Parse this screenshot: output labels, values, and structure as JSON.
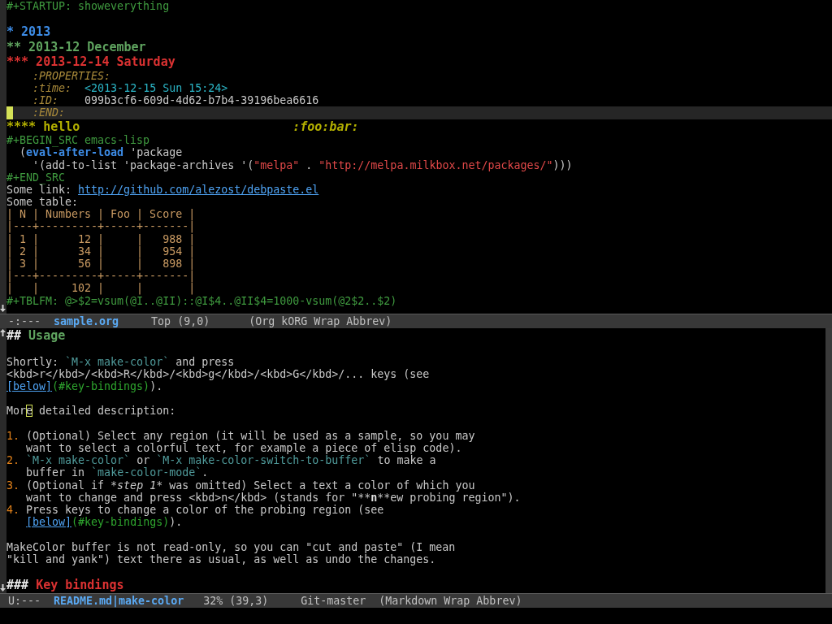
{
  "panes": [
    {
      "fringe": {
        "top_arrow": false,
        "bottom_arrow": true
      },
      "scroll_bar": false,
      "lines": [
        {
          "kind": "text",
          "current": false,
          "segments": [
            {
              "text": "#+STARTUP: showeverything",
              "kind": "meta"
            }
          ]
        },
        {
          "kind": "text",
          "current": false
        },
        {
          "kind": "heading",
          "current": false,
          "segments": [
            {
              "text": "* 2013",
              "kind": "h1"
            }
          ]
        },
        {
          "kind": "heading",
          "current": false,
          "segments": [
            {
              "text": "** 2013-12 December",
              "kind": "h2"
            }
          ]
        },
        {
          "kind": "heading",
          "current": false,
          "segments": [
            {
              "text": "*** 2013-12-14 Saturday",
              "kind": "h3"
            }
          ]
        },
        {
          "kind": "text",
          "current": false,
          "segments": [
            {
              "text": "    :PROPERTIES:",
              "kind": "drawer"
            }
          ]
        },
        {
          "kind": "text",
          "current": false,
          "segments": [
            {
              "text": "    :time:",
              "kind": "drawer"
            },
            {
              "text": "  <2013-12-15 Sun 15:24>",
              "kind": "date"
            }
          ]
        },
        {
          "kind": "text",
          "current": false,
          "segments": [
            {
              "text": "    :ID:",
              "kind": "drawer"
            },
            {
              "text": "    099b3cf6-609d-4d62-b7b4-39196bea6616",
              "kind": "default"
            }
          ]
        },
        {
          "kind": "text",
          "current": true,
          "segments": [
            {
              "text": "    :END:",
              "kind": "drawer"
            }
          ]
        },
        {
          "kind": "heading",
          "current": false,
          "segments": [
            {
              "text": "**** hello",
              "kind": "h4"
            },
            {
              "text": "                             :foo:bar:",
              "kind": "tag"
            }
          ]
        },
        {
          "kind": "text",
          "current": false,
          "segments": [
            {
              "text": "#+BEGIN_SRC emacs-lisp",
              "kind": "meta"
            }
          ]
        },
        {
          "kind": "text",
          "current": false,
          "segments": [
            {
              "text": "  (",
              "kind": "default"
            },
            {
              "text": "eval-after-load",
              "kind": "keyword"
            },
            {
              "text": " 'package",
              "kind": "default"
            }
          ]
        },
        {
          "kind": "text",
          "current": false,
          "segments": [
            {
              "text": "    '(add-to-list 'package-archives '(",
              "kind": "default"
            },
            {
              "text": "\"melpa\"",
              "kind": "string"
            },
            {
              "text": " . ",
              "kind": "default"
            },
            {
              "text": "\"http://melpa.milkbox.net/packages/\"",
              "kind": "string"
            },
            {
              "text": ")))",
              "kind": "default"
            }
          ]
        },
        {
          "kind": "text",
          "current": false,
          "segments": [
            {
              "text": "#+END_SRC",
              "kind": "meta"
            }
          ]
        },
        {
          "kind": "text",
          "current": false,
          "segments": [
            {
              "text": "Some link:",
              "kind": "default"
            },
            {
              "text": " http://github.com/alezost/debpaste.el",
              "kind": "link"
            }
          ]
        },
        {
          "kind": "text",
          "current": false,
          "segments": [
            {
              "text": "Some table:",
              "kind": "default"
            }
          ]
        },
        {
          "kind": "text",
          "current": false,
          "segments": [
            {
              "text": "| N | Numbers | Foo | Score |",
              "kind": "table"
            }
          ]
        },
        {
          "kind": "text",
          "current": false,
          "segments": [
            {
              "text": "|---+---------+-----+-------|",
              "kind": "table"
            }
          ]
        },
        {
          "kind": "text",
          "current": false,
          "segments": [
            {
              "text": "| 1 |      12 |     |   988 |",
              "kind": "table"
            }
          ]
        },
        {
          "kind": "text",
          "current": false,
          "segments": [
            {
              "text": "| 2 |      34 |     |   954 |",
              "kind": "table"
            }
          ]
        },
        {
          "kind": "text",
          "current": false,
          "segments": [
            {
              "text": "| 3 |      56 |     |   898 |",
              "kind": "table"
            }
          ]
        },
        {
          "kind": "text",
          "current": false,
          "segments": [
            {
              "text": "|---+---------+-----+-------|",
              "kind": "table"
            }
          ]
        },
        {
          "kind": "text",
          "current": false,
          "segments": [
            {
              "text": "|   |     102 |     |       |",
              "kind": "table"
            }
          ]
        },
        {
          "kind": "text",
          "current": false,
          "segments": [
            {
              "text": "#+TBLFM: @>$2=vsum(@I..@II)::@I$4..@II$4=1000-vsum(@2$2..$2)",
              "kind": "meta"
            }
          ]
        }
      ],
      "mode_line": [
        {
          "kind": "status",
          "text": "-:---"
        },
        {
          "kind": "buffer",
          "text": "sample.org"
        },
        {
          "kind": "position",
          "text": "Top (9,0)"
        },
        {
          "kind": "modes",
          "text": "(Org kORG Wrap Abbrev)"
        }
      ]
    },
    {
      "fringe": {
        "top_arrow": true,
        "bottom_arrow": true
      },
      "scroll_bar": true,
      "lines": [
        {
          "kind": "heading",
          "current": false,
          "segments": [
            {
              "text": "##",
              "kind": "mdmark"
            },
            {
              "text": " Usage",
              "kind": "h2"
            }
          ]
        },
        {
          "kind": "text",
          "current": false
        },
        {
          "kind": "text",
          "current": false,
          "segments": [
            {
              "text": "Shortly:",
              "kind": "default"
            },
            {
              "text": " `M-x make-color`",
              "kind": "code"
            },
            {
              "text": " and press",
              "kind": "default"
            }
          ]
        },
        {
          "kind": "text",
          "current": false,
          "segments": [
            {
              "text": "<kbd>r</kbd>/<kbd>R</kbd>/<kbd>g</kbd>/<kbd>G</kbd>/... keys (see",
              "kind": "default"
            }
          ]
        },
        {
          "kind": "text",
          "current": false,
          "segments": [
            {
              "text": "[below]",
              "kind": "link"
            },
            {
              "text": "(#key-bindings)",
              "kind": "url"
            },
            {
              "text": ").",
              "kind": "default"
            }
          ]
        },
        {
          "kind": "text",
          "current": false
        },
        {
          "kind": "text",
          "current": false,
          "segments": [
            {
              "text": "Mor",
              "kind": "default"
            },
            {
              "text": "e",
              "kind": "cursor_box"
            },
            {
              "text": " detailed description:",
              "kind": "default"
            }
          ]
        },
        {
          "kind": "text",
          "current": false
        },
        {
          "kind": "text",
          "current": false,
          "segments": [
            {
              "text": "1.",
              "kind": "listnum"
            },
            {
              "text": " (Optional) Select any region (it will be used as a sample, so you may",
              "kind": "default"
            }
          ]
        },
        {
          "kind": "text",
          "current": false,
          "segments": [
            {
              "text": "   want to select a colorful text, for example a piece of elisp code).",
              "kind": "default"
            }
          ]
        },
        {
          "kind": "text",
          "current": false,
          "segments": [
            {
              "text": "2.",
              "kind": "listnum"
            },
            {
              "text": " `M-x make-color`",
              "kind": "code"
            },
            {
              "text": " or",
              "kind": "default"
            },
            {
              "text": " `M-x make-color-switch-to-buffer`",
              "kind": "code"
            },
            {
              "text": " to make a",
              "kind": "default"
            }
          ]
        },
        {
          "kind": "text",
          "current": false,
          "segments": [
            {
              "text": "   buffer in",
              "kind": "default"
            },
            {
              "text": " `make-color-mode`",
              "kind": "code"
            },
            {
              "text": ".",
              "kind": "default"
            }
          ]
        },
        {
          "kind": "text",
          "current": false,
          "segments": [
            {
              "text": "3.",
              "kind": "listnum"
            },
            {
              "text": " (Optional if *",
              "kind": "default"
            },
            {
              "text": "step 1",
              "kind": "italic"
            },
            {
              "text": "* was omitted) Select a text a color of which you",
              "kind": "default"
            }
          ]
        },
        {
          "kind": "text",
          "current": false,
          "segments": [
            {
              "text": "   want to change and press <kbd>n</kbd> (stands for \"**",
              "kind": "default"
            },
            {
              "text": "n",
              "kind": "bold"
            },
            {
              "text": "**ew probing region\").",
              "kind": "default"
            }
          ]
        },
        {
          "kind": "text",
          "current": false,
          "segments": [
            {
              "text": "4.",
              "kind": "listnum"
            },
            {
              "text": " Press keys to change a color of the probing region (see",
              "kind": "default"
            }
          ]
        },
        {
          "kind": "text",
          "current": false,
          "segments": [
            {
              "text": "   [below]",
              "kind": "link"
            },
            {
              "text": "(#key-bindings)",
              "kind": "url"
            },
            {
              "text": ").",
              "kind": "default"
            }
          ]
        },
        {
          "kind": "text",
          "current": false
        },
        {
          "kind": "text",
          "current": false,
          "segments": [
            {
              "text": "MakeColor buffer is not read-only, so you can \"cut and paste\" (I mean",
              "kind": "default"
            }
          ]
        },
        {
          "kind": "text",
          "current": false,
          "segments": [
            {
              "text": "\"kill and yank\") text there as usual, as well as undo the changes.",
              "kind": "default"
            }
          ]
        },
        {
          "kind": "text",
          "current": false
        },
        {
          "kind": "heading",
          "current": false,
          "segments": [
            {
              "text": "###",
              "kind": "mdmark"
            },
            {
              "text": " Key bindings",
              "kind": "h3"
            }
          ]
        }
      ],
      "mode_line": [
        {
          "kind": "status",
          "text": "U:---"
        },
        {
          "kind": "buffer",
          "text": "README.md|make-color"
        },
        {
          "kind": "position",
          "text": "32% (39,3)"
        },
        {
          "kind": "vc",
          "text": "Git-master"
        },
        {
          "kind": "modes",
          "text": "(Markdown Wrap Abbrev)"
        }
      ]
    }
  ]
}
